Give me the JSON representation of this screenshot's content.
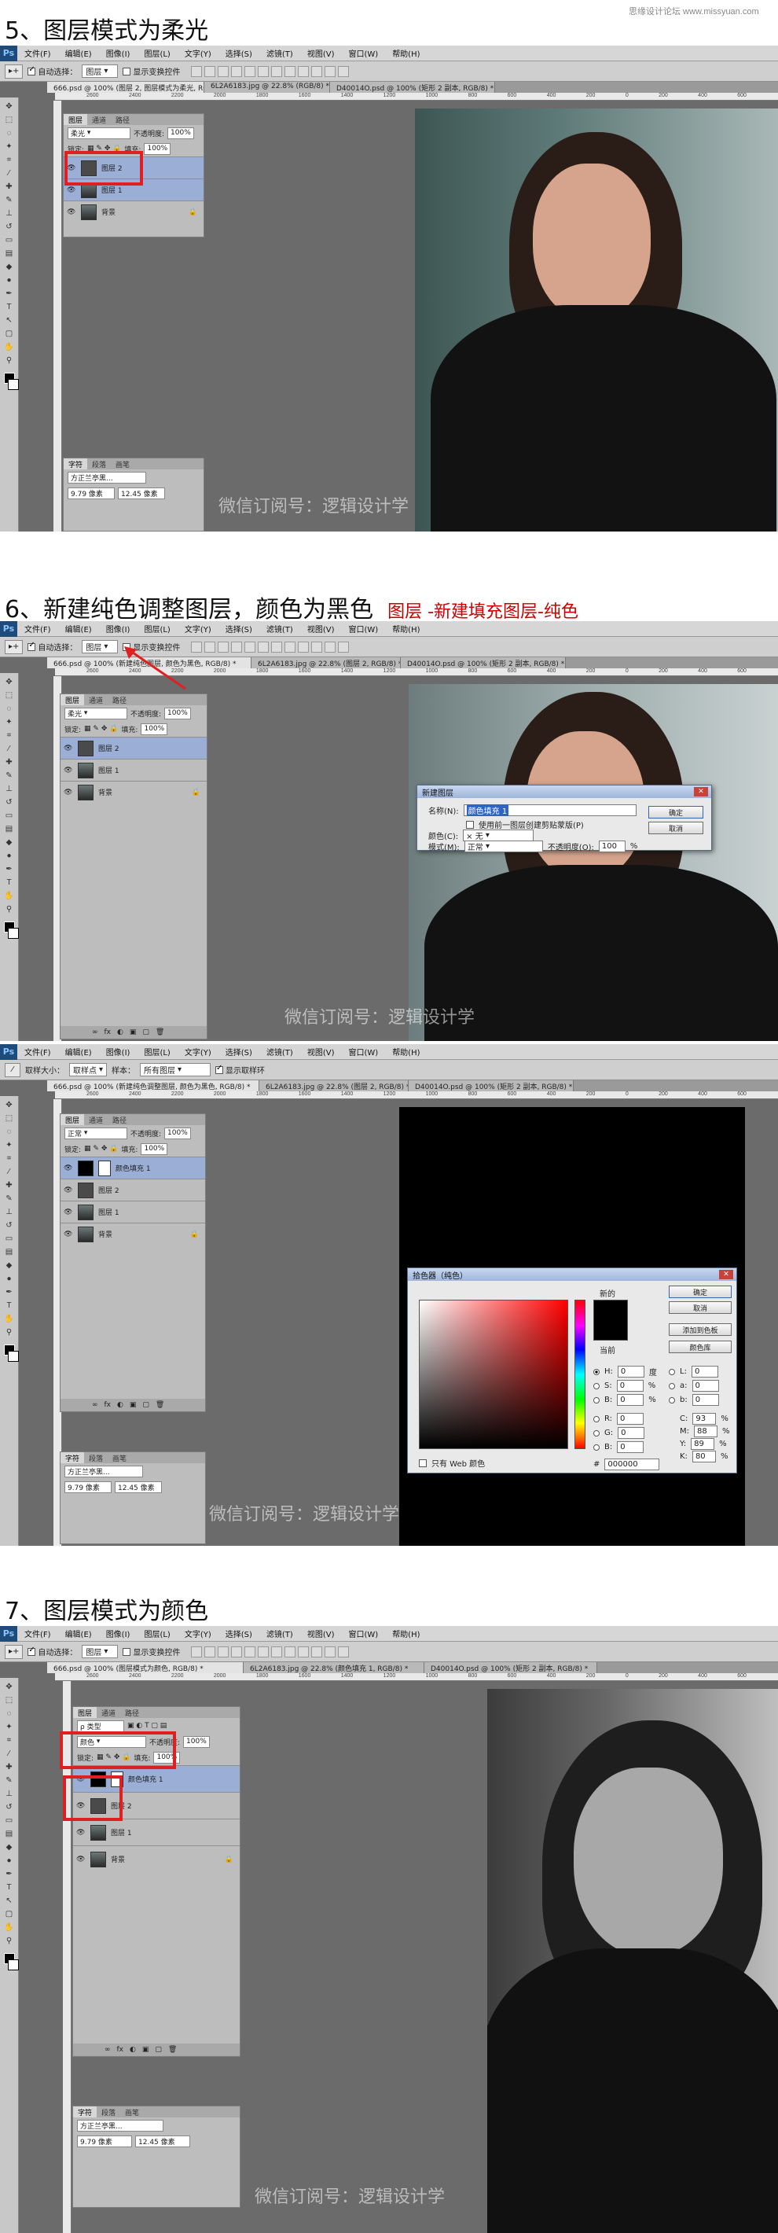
{
  "watermark": "思缘设计论坛 www.missyuan.com",
  "menu": [
    "文件(F)",
    "编辑(E)",
    "图像(I)",
    "图层(L)",
    "文字(Y)",
    "选择(S)",
    "滤镜(T)",
    "视图(V)",
    "窗口(W)",
    "帮助(H)"
  ],
  "sections": [
    {
      "title": "5、图层模式为柔光",
      "options": {
        "auto_select": "自动选择：",
        "auto_select_value": "图层",
        "show_transform": "显示变换控件"
      },
      "tabs": [
        "666.psd @ 100% (图层 2, 图层模式为柔光, RGB/8) *",
        "6L2A6183.jpg @ 22.8% (RGB/8) *",
        "D40014O.psd @ 100% (矩形 2 副本, RGB/8) *"
      ],
      "panel_tabs": [
        "图层",
        "通道",
        "路径"
      ],
      "blend_mode": "柔光",
      "opacity_label": "不透明度:",
      "opacity": "100%",
      "lock_label": "锁定:",
      "fill_label": "填充:",
      "fill": "100%",
      "layers": [
        "图层 2",
        "图层 1",
        "背景"
      ],
      "char_tabs": [
        "字符",
        "段落",
        "画笔"
      ],
      "font": "方正兰亭黑...",
      "size": "9.79 像素",
      "leading": "12.45 像素",
      "watermark": "微信订阅号：逻辑设计学"
    },
    {
      "title": "6、新建纯色调整图层，颜色为黑色",
      "subtitle": "图层 -新建填充图层-纯色",
      "tabs": [
        "666.psd @ 100% (新建纯色图层, 颜色为黑色, RGB/8) *",
        "6L2A6183.jpg @ 22.8% (图层 2, RGB/8) *",
        "D40014O.psd @ 100% (矩形 2 副本, RGB/8) *"
      ],
      "layers": [
        "图层 2",
        "图层 1",
        "背景"
      ],
      "dialog": {
        "title": "新建图层",
        "name_label": "名称(N):",
        "name_value": "颜色填充 1",
        "clip_label": "使用前一图层创建剪贴蒙版(P)",
        "color_label": "颜色(C):",
        "color_value": "× 无",
        "mode_label": "模式(M):",
        "mode_value": "正常",
        "opacity_label": "不透明度(O):",
        "opacity_value": "100",
        "opacity_unit": "%",
        "ok": "确定",
        "cancel": "取消"
      },
      "watermark": "微信订阅号：逻辑设计学"
    },
    {
      "tabs": [
        "666.psd @ 100% (新建纯色调整图层, 颜色为黑色, RGB/8) *",
        "6L2A6183.jpg @ 22.8% (图层 2, RGB/8) *",
        "D40014O.psd @ 100% (矩形 2 副本, RGB/8) *"
      ],
      "options": {
        "sample_size": "取样大小：",
        "sample_value": "取样点",
        "sample": "样本：",
        "sample_all": "所有图层",
        "show_ring": "显示取样环"
      },
      "layers": [
        "颜色填充 1",
        "图层 2",
        "图层 1",
        "背景"
      ],
      "picker": {
        "title": "拾色器（纯色）",
        "new_label": "新的",
        "current_label": "当前",
        "ok": "确定",
        "cancel": "取消",
        "add_swatch": "添加到色板",
        "libraries": "颜色库",
        "web_only": "只有 Web 颜色",
        "hex_label": "#",
        "hex": "000000",
        "hsb": [
          [
            "H:",
            "0",
            "度"
          ],
          [
            "S:",
            "0",
            "%"
          ],
          [
            "B:",
            "0",
            "%"
          ]
        ],
        "rgb": [
          [
            "R:",
            "0"
          ],
          [
            "G:",
            "0"
          ],
          [
            "B:",
            "0"
          ]
        ],
        "lab": [
          [
            "L:",
            "0"
          ],
          [
            "a:",
            "0"
          ],
          [
            "b:",
            "0"
          ]
        ],
        "cmyk": [
          [
            "C:",
            "93",
            "%"
          ],
          [
            "M:",
            "88",
            "%"
          ],
          [
            "Y:",
            "89",
            "%"
          ],
          [
            "K:",
            "80",
            "%"
          ]
        ]
      },
      "watermark": "微信订阅号：逻辑设计学"
    },
    {
      "title": "7、图层模式为颜色",
      "tabs": [
        "666.psd @ 100% (图层模式为颜色, RGB/8) *",
        "6L2A6183.jpg @ 22.8% (颜色填充 1, RGB/8) *",
        "D40014O.psd @ 100% (矩形 2 副本, RGB/8) *"
      ],
      "filter_label": "ρ 类型",
      "blend_mode": "颜色",
      "layers": [
        "颜色填充 1",
        "图层 2",
        "图层 1",
        "背景"
      ],
      "font": "方正兰亭黑...",
      "size": "9.79 像素",
      "leading": "12.45 像素",
      "watermark": "微信订阅号：逻辑设计学"
    }
  ]
}
